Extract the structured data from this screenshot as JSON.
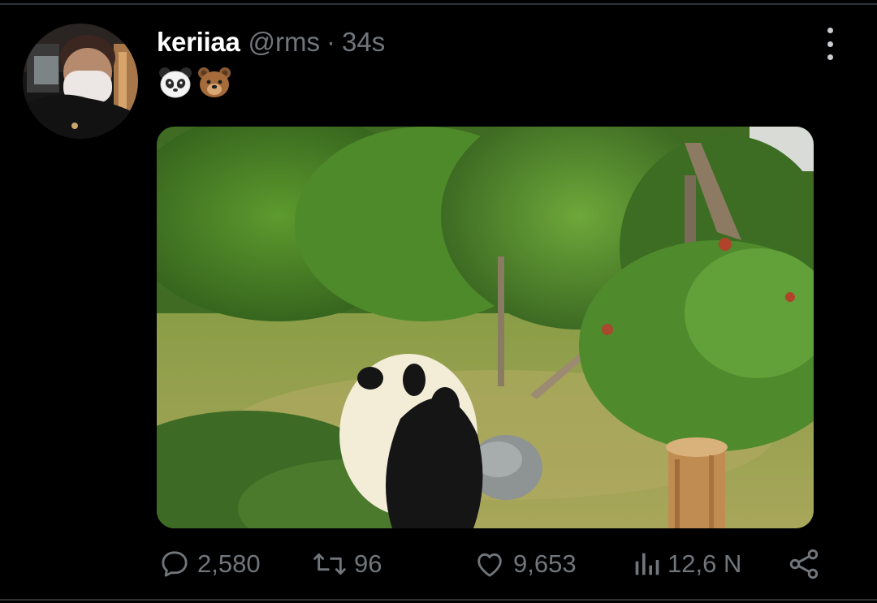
{
  "tweet": {
    "display_name": "keriiaa",
    "handle": "@rms",
    "separator": "·",
    "time": "34s",
    "emojis": [
      "panda-face",
      "bear-face"
    ]
  },
  "actions": {
    "reply_count": "2,580",
    "retweet_count": "96",
    "like_count": "9,653",
    "views_count": "12,6 N"
  },
  "icons": [
    "more-vertical",
    "reply",
    "retweet",
    "like",
    "views",
    "share"
  ],
  "colors": {
    "background": "#000000",
    "primary_text": "#ffffff",
    "secondary_text": "#71767b",
    "divider": "#2f3336"
  }
}
